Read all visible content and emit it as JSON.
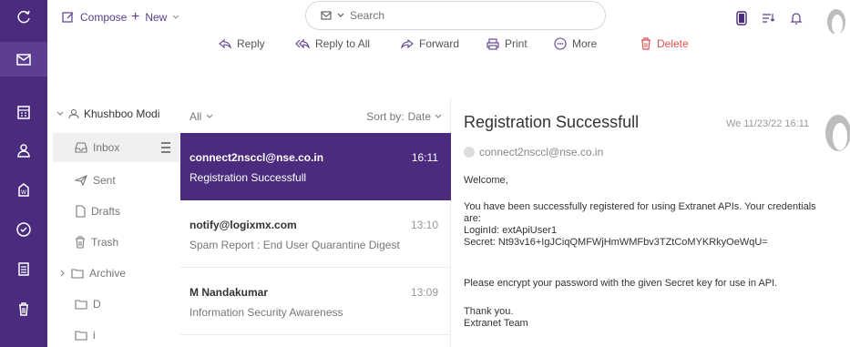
{
  "topbar": {
    "compose_label": "Compose",
    "new_label": "New",
    "search_placeholder": "Search"
  },
  "actions": {
    "reply": "Reply",
    "reply_all": "Reply to All",
    "forward": "Forward",
    "print": "Print",
    "more": "More",
    "delete": "Delete"
  },
  "sidebar": {
    "icons": [
      "refresh-icon",
      "mail-icon",
      "calendar-icon",
      "contacts-icon",
      "briefcase-icon",
      "tasks-icon",
      "notes-icon",
      "trash-icon"
    ]
  },
  "folders": {
    "account": "Khushboo Modi",
    "items": [
      {
        "label": "Inbox",
        "icon": "inbox-icon"
      },
      {
        "label": "Sent",
        "icon": "sent-icon"
      },
      {
        "label": "Drafts",
        "icon": "drafts-icon"
      },
      {
        "label": "Trash",
        "icon": "trash-icon"
      },
      {
        "label": "Archive",
        "icon": "folder-icon"
      },
      {
        "label": "D",
        "icon": "folder-icon"
      },
      {
        "label": "i",
        "icon": "folder-icon"
      }
    ]
  },
  "list": {
    "filter": "All",
    "sort_label": "Sort by:",
    "sort_value": "Date",
    "messages": [
      {
        "from": "connect2nsccl@nse.co.in",
        "time": "16:11",
        "subject": "Registration Successfull"
      },
      {
        "from": "notify@logixmx.com",
        "time": "13:10",
        "subject": "Spam Report : End User Quarantine Digest"
      },
      {
        "from": "M Nandakumar",
        "time": "13:09",
        "subject": "Information Security Awareness"
      }
    ]
  },
  "reader": {
    "subject": "Registration Successfull",
    "date": "We 11/23/22 16:11",
    "sender": "connect2nsccl@nse.co.in",
    "body": {
      "greeting": "Welcome,",
      "line1": "You have been successfully registered for using Extranet APIs. Your credentials are:",
      "line2": "LoginId: extApiUser1",
      "line3": "Secret: Nt93v16+IgJCiqQMFWjHmWMFbv3TZtCoMYKRkyOeWqU=",
      "line4": "Please encrypt your password with the given Secret key for use in API.",
      "thanks": "Thank you.",
      "signature": "Extranet Team"
    }
  },
  "colors": {
    "rail": "#4a2b7e",
    "accent": "#5a3d8e",
    "delete": "#e05050"
  }
}
